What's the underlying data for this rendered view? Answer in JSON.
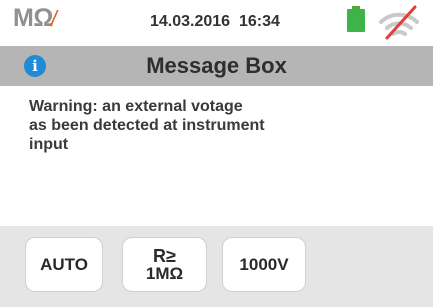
{
  "status_bar": {
    "mode_label": "MΩ",
    "mode_slash": "/",
    "datetime": "14.03.2016  16:34",
    "battery_icon": "battery-full-icon",
    "signal_icon": "wireless-disabled-icon"
  },
  "title_bar": {
    "info_icon": "i",
    "title": "Message Box"
  },
  "message": {
    "text": "Warning: an external votage\nas been detected at instrument\ninput"
  },
  "buttons": {
    "auto_label": "AUTO",
    "r_line1": "R≥",
    "r_line2": "1MΩ",
    "voltage_label": "1000V"
  },
  "colors": {
    "title_bar": "#b5b5b5",
    "info_icon": "#1f8ad6",
    "battery": "#3eb34a",
    "slash_accent": "#e3621b",
    "wifi_cross": "#e0403a"
  }
}
